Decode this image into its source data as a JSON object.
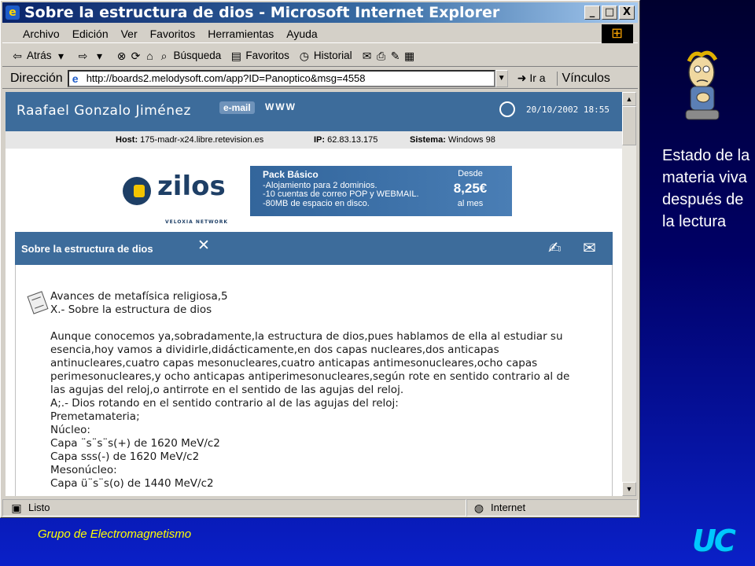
{
  "window": {
    "title": "Sobre la estructura de dios - Microsoft Internet Explorer",
    "controls": {
      "minimize": "_",
      "maximize": "□",
      "close": "X"
    }
  },
  "menu": [
    "Archivo",
    "Edición",
    "Ver",
    "Favoritos",
    "Herramientas",
    "Ayuda"
  ],
  "toolbar": {
    "back": "Atrás",
    "search": "Búsqueda",
    "favorites": "Favoritos",
    "history": "Historial"
  },
  "address": {
    "label": "Dirección",
    "url": "http://boards2.melodysoft.com/app?ID=Panoptico&msg=4558",
    "go": "Ir a",
    "links": "Vínculos"
  },
  "page": {
    "author": "Raafael Gonzalo Jiménez",
    "email": "e-mail",
    "www": "WWW",
    "datetime": "20/10/2002 18:55",
    "host_label": "Host:",
    "host": "175-madr-x24.libre.retevision.es",
    "ip_label": "IP:",
    "ip": "62.83.13.175",
    "system_label": "Sistema:",
    "system": "Windows 98"
  },
  "banner": {
    "brand": "zilos",
    "brand_sub": "VELOXIA NETWORK",
    "title": "Pack Básico",
    "lines": [
      "-Alojamiento para 2 dominios.",
      "-10 cuentas de correo POP y WEBMAIL.",
      "-80MB de espacio en disco."
    ],
    "price_from": "Desde",
    "price": "8,25€",
    "price_period": "al mes"
  },
  "article": {
    "header": "Sobre la estructura de dios",
    "lines": [
      "Avances de metafísica religiosa,5",
      "X.- Sobre la estructura de dios",
      "",
      "Aunque conocemos ya,sobradamente,la estructura de dios,pues hablamos de ella al estudiar su",
      "esencia,hoy vamos a dividirle,didácticamente,en dos capas nucleares,dos anticapas",
      "antinucleares,cuatro capas mesonucleares,cuatro anticapas antimesonucleares,ocho capas",
      "perimesonucleares,y ocho anticapas antiperimesonucleares,según rote en sentido contrario al de",
      "las agujas del reloj,o antirrote en el sentido de las agujas del reloj.",
      "A;.- Dios rotando en el sentido contrario al de las agujas del reloj:",
      "Premetamateria;",
      "Núcleo:",
      "Capa ¨s¨s¨s(+) de 1620 MeV/c2",
      "Capa sss(-) de 1620 MeV/c2",
      "Mesonúcleo:",
      "Capa ü¨s¨s(o) de 1440 MeV/c2"
    ]
  },
  "status": {
    "left": "Listo",
    "right": "Internet"
  },
  "side_text": "Estado de la materia viva después de la lectura",
  "footer": "Grupo de Electromagnetismo",
  "logo": "UC"
}
